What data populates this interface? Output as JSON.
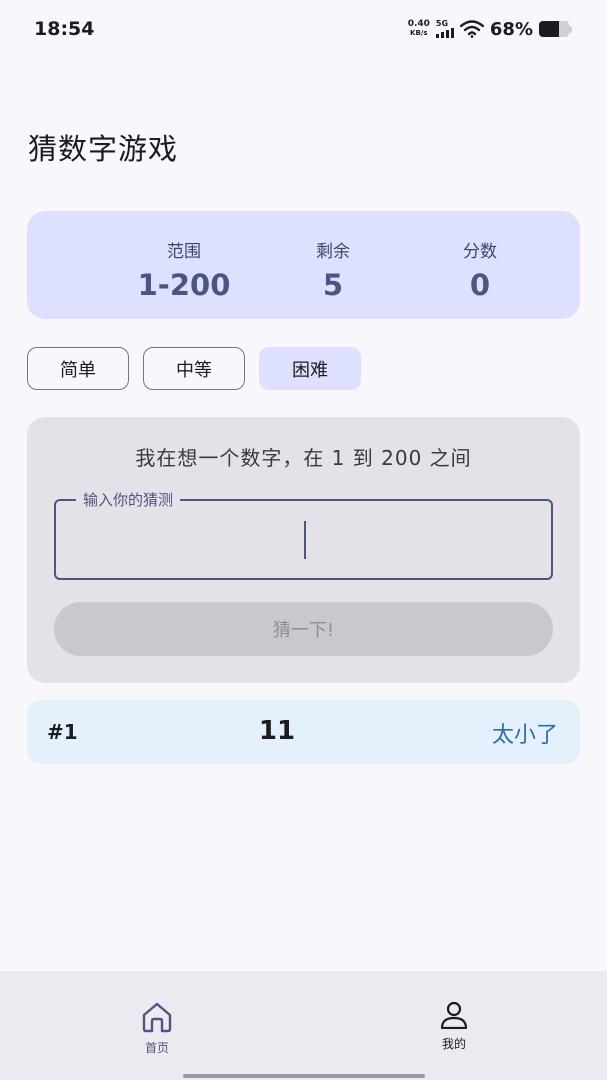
{
  "status_bar": {
    "time": "18:54",
    "net_speed_value": "0.40",
    "net_speed_unit": "KB/s",
    "network_type": "5G",
    "battery_percent": "68%",
    "battery_level": 0.68
  },
  "header": {
    "title": "猜数字游戏"
  },
  "stats": {
    "range_label": "范围",
    "range_value": "1-200",
    "remaining_label": "剩余",
    "remaining_value": "5",
    "score_label": "分数",
    "score_value": "0"
  },
  "difficulty": {
    "options": [
      {
        "label": "简单",
        "active": false
      },
      {
        "label": "中等",
        "active": false
      },
      {
        "label": "困难",
        "active": true
      }
    ]
  },
  "game": {
    "prompt": "我在想一个数字，在 1 到 200 之间",
    "input_label": "输入你的猜测",
    "input_value": "",
    "guess_button": "猜一下!"
  },
  "history": [
    {
      "index": "#1",
      "guess": "11",
      "result": "太小了"
    }
  ],
  "nav": {
    "home_label": "首页",
    "profile_label": "我的"
  },
  "colors": {
    "accent": "#4a5582",
    "stats_bg": "#dde1ff",
    "history_bg": "#e4f1fc",
    "result_text": "#2c6ea8"
  }
}
